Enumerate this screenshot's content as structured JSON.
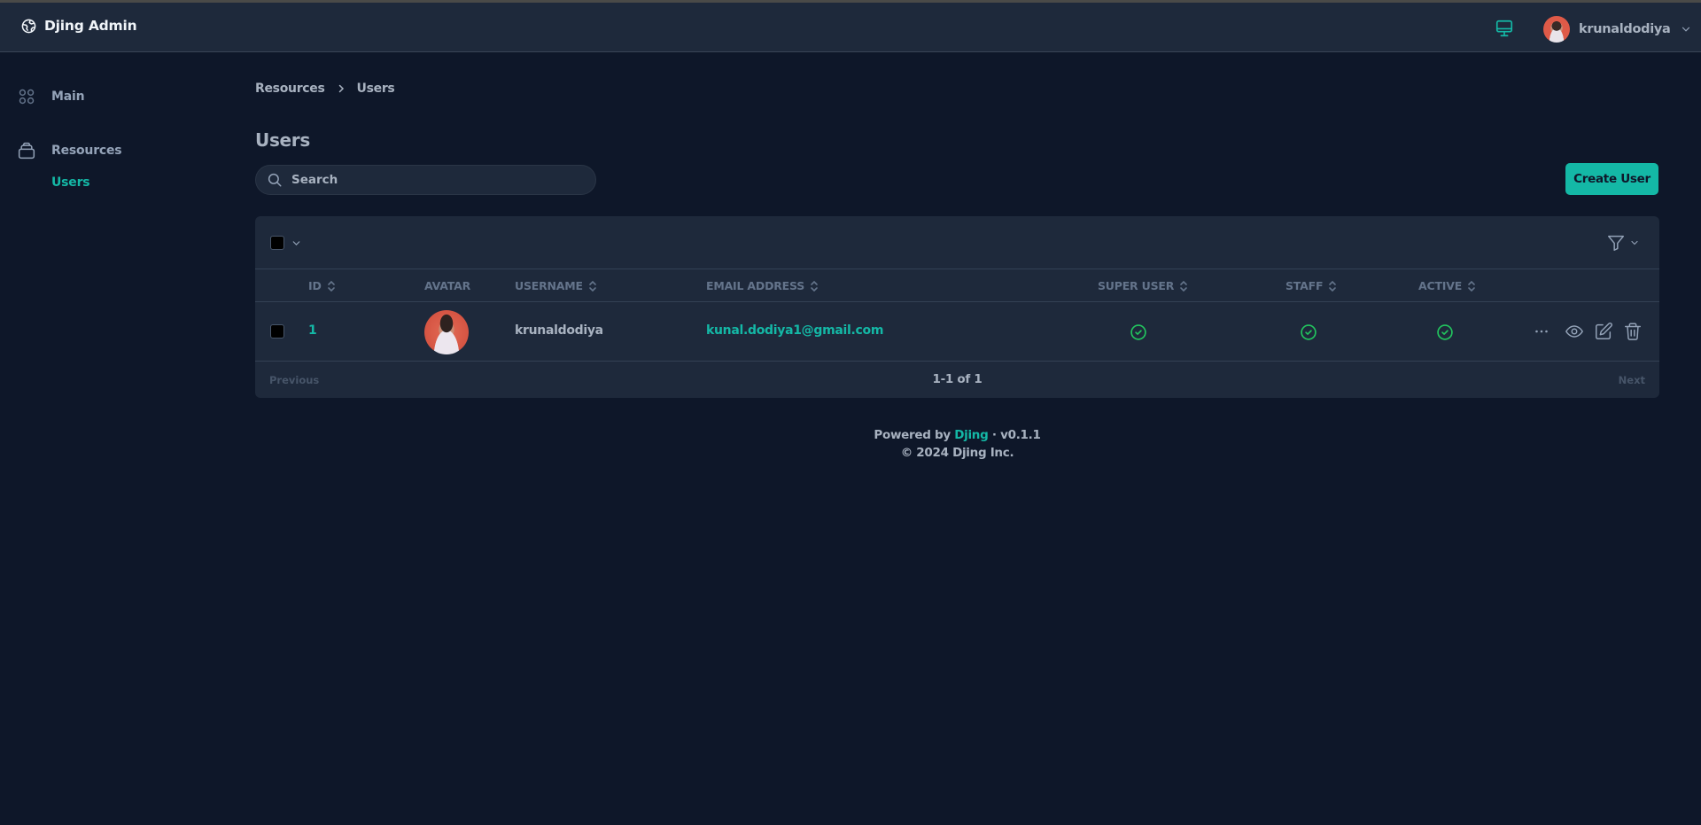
{
  "header": {
    "app_title": "Djing Admin",
    "user_name": "krunaldodiya",
    "icons": {
      "logo": "globe-icon",
      "theme": "monitor-icon",
      "user_menu": "chevron-down-icon"
    }
  },
  "sidebar": {
    "items": [
      {
        "label": "Main",
        "icon": "grid-icon"
      },
      {
        "label": "Resources",
        "icon": "archive-icon",
        "children": [
          {
            "label": "Users",
            "active": true
          }
        ]
      }
    ]
  },
  "breadcrumb": {
    "items": [
      "Resources",
      "Users"
    ]
  },
  "page": {
    "title": "Users",
    "search_placeholder": "Search",
    "search_value": "",
    "create_button": "Create User"
  },
  "table": {
    "columns": [
      {
        "label": "ID",
        "sortable": true
      },
      {
        "label": "AVATAR",
        "sortable": false
      },
      {
        "label": "USERNAME",
        "sortable": true
      },
      {
        "label": "EMAIL ADDRESS",
        "sortable": true
      },
      {
        "label": "SUPER USER",
        "sortable": true
      },
      {
        "label": "STAFF",
        "sortable": true
      },
      {
        "label": "ACTIVE",
        "sortable": true
      }
    ],
    "rows": [
      {
        "id": "1",
        "avatar": "user-photo",
        "username": "krunaldodiya",
        "email": "kunal.dodiya1@gmail.com",
        "super_user": true,
        "staff": true,
        "active": true
      }
    ],
    "row_actions": [
      "more",
      "view",
      "edit",
      "delete"
    ]
  },
  "pagination": {
    "previous": "Previous",
    "info": "1-1 of 1",
    "next": "Next"
  },
  "footer": {
    "powered_prefix": "Powered by ",
    "brand": "Djing",
    "version": " · v0.1.1",
    "copyright": "© 2024 Djing Inc."
  },
  "colors": {
    "accent": "#14b8a6",
    "success": "#22c55e",
    "background": "#0e1729",
    "surface": "#1e293b"
  }
}
